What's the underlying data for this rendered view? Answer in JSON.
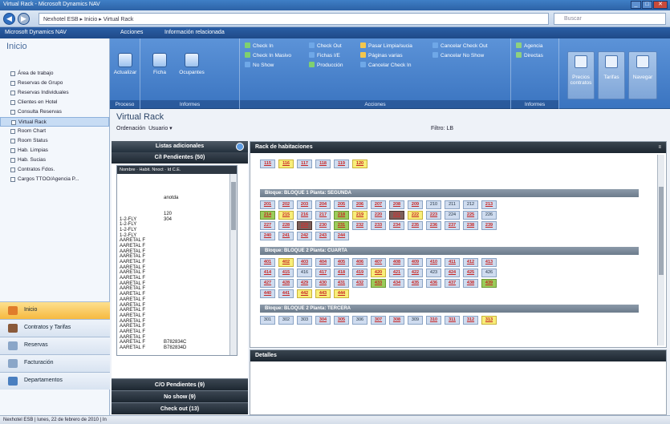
{
  "window": {
    "title": "Virtual Rack - Microsoft Dynamics NAV"
  },
  "address": {
    "path": "Nexhotel ESB  ▸  Inicio  ▸  Virtual Rack",
    "search_placeholder": "Buscar"
  },
  "menubar": {
    "app": "Microsoft Dynamics NAV",
    "acciones": "Acciones",
    "info": "Información relacionada"
  },
  "ribbon": {
    "groups": [
      "Proceso",
      "Informes",
      "Acciones",
      "Informes"
    ],
    "big_buttons": [
      "Actualizar",
      "Ficha",
      "Ocupantes"
    ],
    "col1": [
      "Check In",
      "Check In Masivo",
      "No Show"
    ],
    "col2": [
      "Check Out",
      "Fichas I/E",
      "Producción"
    ],
    "col3": [
      "Pasar Limpia/sucia",
      "Páginas varias",
      "Cancelar Check In"
    ],
    "col4": [
      "Cancelar Check Out",
      "Cancelar No Show"
    ],
    "col5": [
      "Agencia",
      "Directas"
    ],
    "right_buttons": [
      "Precios contratos",
      "Tarifas",
      "Navegar"
    ]
  },
  "nav": {
    "title": "Inicio",
    "items": [
      "Área de trabajo",
      "Reservas de Grupo",
      "Reservas Individuales",
      "Clientes en Hotel",
      "Consulta Reservas",
      "Virtual Rack",
      "Room Chart",
      "Room Status",
      "Hab. Limpias",
      "Hab. Sucias",
      "Contratos Fdos.",
      "Cargos TTOO/Agencia P..."
    ],
    "buttons": [
      "Inicio",
      "Contratos y Tarifas",
      "Reservas",
      "Facturación",
      "Departamentos"
    ]
  },
  "main": {
    "title": "Virtual Rack",
    "orden_label": "Ordenación",
    "orden_value": "Usuario",
    "filtro": "Filtro: LB",
    "panel_title": "Listas adicionales",
    "pendientes_ci": "C/I Pendientes (50)",
    "grid_header": "Nombre  ·  Habit.  Nnoct  ·  Id C.E.",
    "grid_rows": [
      {
        "a": "",
        "b": ""
      },
      {
        "a": "",
        "b": ""
      },
      {
        "a": "",
        "b": ""
      },
      {
        "a": "",
        "b": ""
      },
      {
        "a": "",
        "b": "anotda"
      },
      {
        "a": "",
        "b": ""
      },
      {
        "a": "",
        "b": ""
      },
      {
        "a": "",
        "b": "120"
      },
      {
        "a": "1-2-FLY",
        "b": "304"
      },
      {
        "a": "1-2-FLY",
        "b": ""
      },
      {
        "a": "1-2-FLY",
        "b": ""
      },
      {
        "a": "1-2-FLY",
        "b": ""
      },
      {
        "a": "AARETAL F",
        "b": ""
      },
      {
        "a": "AARETAL F",
        "b": ""
      },
      {
        "a": "AARETAL F",
        "b": ""
      },
      {
        "a": "AARETAL F",
        "b": ""
      },
      {
        "a": "AARETAL F",
        "b": ""
      },
      {
        "a": "AARETAL F",
        "b": ""
      },
      {
        "a": "AARETAL F",
        "b": ""
      },
      {
        "a": "AARETAL F",
        "b": ""
      },
      {
        "a": "AARETAL F",
        "b": ""
      },
      {
        "a": "AARETAL F",
        "b": ""
      },
      {
        "a": "AARETAL F",
        "b": ""
      },
      {
        "a": "AARETAL F",
        "b": ""
      },
      {
        "a": "AARETAL F",
        "b": ""
      },
      {
        "a": "AARETAL F",
        "b": ""
      },
      {
        "a": "AARETAL F",
        "b": ""
      },
      {
        "a": "AARETAL F",
        "b": ""
      },
      {
        "a": "AARETAL F",
        "b": ""
      },
      {
        "a": "AARETAL F",
        "b": ""
      },
      {
        "a": "AARETAL F",
        "b": ""
      },
      {
        "a": "AARETAL F",
        "b": "B782834C"
      },
      {
        "a": "AARETAL F",
        "b": "B782834D"
      }
    ],
    "pendientes_co": "C/O Pendientes (9)",
    "no_show": "No show (9)",
    "check_out": "Check out (13)",
    "rack_title": "Rack de habitaciones",
    "detalles": "Detalles"
  },
  "rack": {
    "top": [
      {
        "n": "115",
        "s": "r"
      },
      {
        "n": "116",
        "s": "y"
      },
      {
        "n": "117",
        "s": "r"
      },
      {
        "n": "118",
        "s": "r"
      },
      {
        "n": "119",
        "s": "r"
      },
      {
        "n": "120",
        "s": "y"
      }
    ],
    "b1_label": "Bloque: BLOQUE 1    Planta: SEGUNDA",
    "b1": [
      [
        {
          "n": "201",
          "s": "r"
        },
        {
          "n": "202",
          "s": "r"
        },
        {
          "n": "203",
          "s": "r"
        },
        {
          "n": "204",
          "s": "r"
        },
        {
          "n": "205",
          "s": "r"
        },
        {
          "n": "206",
          "s": "r"
        },
        {
          "n": "207",
          "s": "r"
        },
        {
          "n": "208",
          "s": "r"
        },
        {
          "n": "209",
          "s": "r"
        },
        {
          "n": "210",
          "s": "n"
        },
        {
          "n": "211",
          "s": "n"
        },
        {
          "n": "212",
          "s": "n"
        },
        {
          "n": "213",
          "s": "r"
        }
      ],
      [
        {
          "n": "214",
          "s": "g"
        },
        {
          "n": "215",
          "s": "y"
        },
        {
          "n": "216",
          "s": "r"
        },
        {
          "n": "217",
          "s": "r"
        },
        {
          "n": "218",
          "s": "g"
        },
        {
          "n": "219",
          "s": "y"
        },
        {
          "n": "220",
          "s": "r"
        },
        {
          "n": "221",
          "s": "gr"
        },
        {
          "n": "222",
          "s": "y"
        },
        {
          "n": "223",
          "s": "r"
        },
        {
          "n": "224",
          "s": "n"
        },
        {
          "n": "225",
          "s": "r"
        },
        {
          "n": "226",
          "s": "n"
        }
      ],
      [
        {
          "n": "227",
          "s": "r"
        },
        {
          "n": "228",
          "s": "r"
        },
        {
          "n": "229",
          "s": "gr"
        },
        {
          "n": "230",
          "s": "r"
        },
        {
          "n": "231",
          "s": "g"
        },
        {
          "n": "232",
          "s": "r"
        },
        {
          "n": "233",
          "s": "r"
        },
        {
          "n": "234",
          "s": "r"
        },
        {
          "n": "235",
          "s": "r"
        },
        {
          "n": "236",
          "s": "r"
        },
        {
          "n": "237",
          "s": "r"
        },
        {
          "n": "238",
          "s": "r"
        },
        {
          "n": "239",
          "s": "r"
        }
      ],
      [
        {
          "n": "240",
          "s": "r"
        },
        {
          "n": "241",
          "s": "r"
        },
        {
          "n": "242",
          "s": "r"
        },
        {
          "n": "243",
          "s": "r"
        },
        {
          "n": "244",
          "s": "r"
        }
      ]
    ],
    "b2_label": "Bloque: BLOQUE 2    Planta: CUARTA",
    "b2": [
      [
        {
          "n": "401",
          "s": "r"
        },
        {
          "n": "402",
          "s": "y"
        },
        {
          "n": "403",
          "s": "r"
        },
        {
          "n": "404",
          "s": "r"
        },
        {
          "n": "405",
          "s": "r"
        },
        {
          "n": "406",
          "s": "r"
        },
        {
          "n": "407",
          "s": "r"
        },
        {
          "n": "408",
          "s": "r"
        },
        {
          "n": "409",
          "s": "r"
        },
        {
          "n": "410",
          "s": "r"
        },
        {
          "n": "411",
          "s": "r"
        },
        {
          "n": "412",
          "s": "r"
        },
        {
          "n": "413",
          "s": "r"
        }
      ],
      [
        {
          "n": "414",
          "s": "r"
        },
        {
          "n": "415",
          "s": "r"
        },
        {
          "n": "416",
          "s": "n"
        },
        {
          "n": "417",
          "s": "r"
        },
        {
          "n": "418",
          "s": "r"
        },
        {
          "n": "419",
          "s": "r"
        },
        {
          "n": "420",
          "s": "y"
        },
        {
          "n": "421",
          "s": "r"
        },
        {
          "n": "422",
          "s": "r"
        },
        {
          "n": "423",
          "s": "n"
        },
        {
          "n": "424",
          "s": "r"
        },
        {
          "n": "425",
          "s": "r"
        },
        {
          "n": "426",
          "s": "n"
        }
      ],
      [
        {
          "n": "427",
          "s": "r"
        },
        {
          "n": "428",
          "s": "r"
        },
        {
          "n": "429",
          "s": "r"
        },
        {
          "n": "430",
          "s": "r"
        },
        {
          "n": "431",
          "s": "r"
        },
        {
          "n": "432",
          "s": "r"
        },
        {
          "n": "433",
          "s": "g"
        },
        {
          "n": "434",
          "s": "r"
        },
        {
          "n": "435",
          "s": "r"
        },
        {
          "n": "436",
          "s": "r"
        },
        {
          "n": "437",
          "s": "r"
        },
        {
          "n": "438",
          "s": "r"
        },
        {
          "n": "439",
          "s": "g"
        }
      ],
      [
        {
          "n": "440",
          "s": "r"
        },
        {
          "n": "441",
          "s": "r"
        },
        {
          "n": "442",
          "s": "y"
        },
        {
          "n": "443",
          "s": "y"
        },
        {
          "n": "444",
          "s": "y"
        }
      ]
    ],
    "b3_label": "Bloque: BLOQUE 2    Planta: TERCERA",
    "b3": [
      [
        {
          "n": "301",
          "s": "n"
        },
        {
          "n": "302",
          "s": "n"
        },
        {
          "n": "303",
          "s": "n"
        },
        {
          "n": "304",
          "s": "r"
        },
        {
          "n": "305",
          "s": "r"
        },
        {
          "n": "306",
          "s": "n"
        },
        {
          "n": "307",
          "s": "r"
        },
        {
          "n": "308",
          "s": "r"
        },
        {
          "n": "309",
          "s": "n"
        },
        {
          "n": "310",
          "s": "r"
        },
        {
          "n": "311",
          "s": "r"
        },
        {
          "n": "312",
          "s": "r"
        },
        {
          "n": "313",
          "s": "y"
        }
      ]
    ]
  },
  "status": {
    "text": "Nexhotel ESB  |  lunes, 22 de febrero de 2010  |  In"
  }
}
